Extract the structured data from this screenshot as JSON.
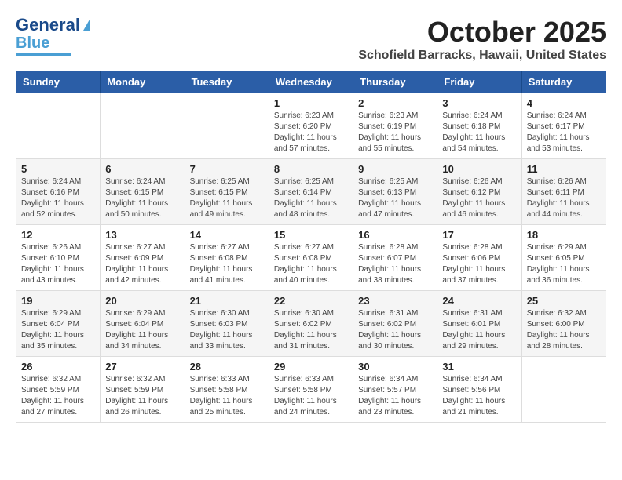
{
  "logo": {
    "line1": "General",
    "line2": "Blue"
  },
  "header": {
    "month": "October 2025",
    "location": "Schofield Barracks, Hawaii, United States"
  },
  "weekdays": [
    "Sunday",
    "Monday",
    "Tuesday",
    "Wednesday",
    "Thursday",
    "Friday",
    "Saturday"
  ],
  "weeks": [
    [
      {
        "day": "",
        "sunrise": "",
        "sunset": "",
        "daylight": ""
      },
      {
        "day": "",
        "sunrise": "",
        "sunset": "",
        "daylight": ""
      },
      {
        "day": "",
        "sunrise": "",
        "sunset": "",
        "daylight": ""
      },
      {
        "day": "1",
        "sunrise": "Sunrise: 6:23 AM",
        "sunset": "Sunset: 6:20 PM",
        "daylight": "Daylight: 11 hours and 57 minutes."
      },
      {
        "day": "2",
        "sunrise": "Sunrise: 6:23 AM",
        "sunset": "Sunset: 6:19 PM",
        "daylight": "Daylight: 11 hours and 55 minutes."
      },
      {
        "day": "3",
        "sunrise": "Sunrise: 6:24 AM",
        "sunset": "Sunset: 6:18 PM",
        "daylight": "Daylight: 11 hours and 54 minutes."
      },
      {
        "day": "4",
        "sunrise": "Sunrise: 6:24 AM",
        "sunset": "Sunset: 6:17 PM",
        "daylight": "Daylight: 11 hours and 53 minutes."
      }
    ],
    [
      {
        "day": "5",
        "sunrise": "Sunrise: 6:24 AM",
        "sunset": "Sunset: 6:16 PM",
        "daylight": "Daylight: 11 hours and 52 minutes."
      },
      {
        "day": "6",
        "sunrise": "Sunrise: 6:24 AM",
        "sunset": "Sunset: 6:15 PM",
        "daylight": "Daylight: 11 hours and 50 minutes."
      },
      {
        "day": "7",
        "sunrise": "Sunrise: 6:25 AM",
        "sunset": "Sunset: 6:15 PM",
        "daylight": "Daylight: 11 hours and 49 minutes."
      },
      {
        "day": "8",
        "sunrise": "Sunrise: 6:25 AM",
        "sunset": "Sunset: 6:14 PM",
        "daylight": "Daylight: 11 hours and 48 minutes."
      },
      {
        "day": "9",
        "sunrise": "Sunrise: 6:25 AM",
        "sunset": "Sunset: 6:13 PM",
        "daylight": "Daylight: 11 hours and 47 minutes."
      },
      {
        "day": "10",
        "sunrise": "Sunrise: 6:26 AM",
        "sunset": "Sunset: 6:12 PM",
        "daylight": "Daylight: 11 hours and 46 minutes."
      },
      {
        "day": "11",
        "sunrise": "Sunrise: 6:26 AM",
        "sunset": "Sunset: 6:11 PM",
        "daylight": "Daylight: 11 hours and 44 minutes."
      }
    ],
    [
      {
        "day": "12",
        "sunrise": "Sunrise: 6:26 AM",
        "sunset": "Sunset: 6:10 PM",
        "daylight": "Daylight: 11 hours and 43 minutes."
      },
      {
        "day": "13",
        "sunrise": "Sunrise: 6:27 AM",
        "sunset": "Sunset: 6:09 PM",
        "daylight": "Daylight: 11 hours and 42 minutes."
      },
      {
        "day": "14",
        "sunrise": "Sunrise: 6:27 AM",
        "sunset": "Sunset: 6:08 PM",
        "daylight": "Daylight: 11 hours and 41 minutes."
      },
      {
        "day": "15",
        "sunrise": "Sunrise: 6:27 AM",
        "sunset": "Sunset: 6:08 PM",
        "daylight": "Daylight: 11 hours and 40 minutes."
      },
      {
        "day": "16",
        "sunrise": "Sunrise: 6:28 AM",
        "sunset": "Sunset: 6:07 PM",
        "daylight": "Daylight: 11 hours and 38 minutes."
      },
      {
        "day": "17",
        "sunrise": "Sunrise: 6:28 AM",
        "sunset": "Sunset: 6:06 PM",
        "daylight": "Daylight: 11 hours and 37 minutes."
      },
      {
        "day": "18",
        "sunrise": "Sunrise: 6:29 AM",
        "sunset": "Sunset: 6:05 PM",
        "daylight": "Daylight: 11 hours and 36 minutes."
      }
    ],
    [
      {
        "day": "19",
        "sunrise": "Sunrise: 6:29 AM",
        "sunset": "Sunset: 6:04 PM",
        "daylight": "Daylight: 11 hours and 35 minutes."
      },
      {
        "day": "20",
        "sunrise": "Sunrise: 6:29 AM",
        "sunset": "Sunset: 6:04 PM",
        "daylight": "Daylight: 11 hours and 34 minutes."
      },
      {
        "day": "21",
        "sunrise": "Sunrise: 6:30 AM",
        "sunset": "Sunset: 6:03 PM",
        "daylight": "Daylight: 11 hours and 33 minutes."
      },
      {
        "day": "22",
        "sunrise": "Sunrise: 6:30 AM",
        "sunset": "Sunset: 6:02 PM",
        "daylight": "Daylight: 11 hours and 31 minutes."
      },
      {
        "day": "23",
        "sunrise": "Sunrise: 6:31 AM",
        "sunset": "Sunset: 6:02 PM",
        "daylight": "Daylight: 11 hours and 30 minutes."
      },
      {
        "day": "24",
        "sunrise": "Sunrise: 6:31 AM",
        "sunset": "Sunset: 6:01 PM",
        "daylight": "Daylight: 11 hours and 29 minutes."
      },
      {
        "day": "25",
        "sunrise": "Sunrise: 6:32 AM",
        "sunset": "Sunset: 6:00 PM",
        "daylight": "Daylight: 11 hours and 28 minutes."
      }
    ],
    [
      {
        "day": "26",
        "sunrise": "Sunrise: 6:32 AM",
        "sunset": "Sunset: 5:59 PM",
        "daylight": "Daylight: 11 hours and 27 minutes."
      },
      {
        "day": "27",
        "sunrise": "Sunrise: 6:32 AM",
        "sunset": "Sunset: 5:59 PM",
        "daylight": "Daylight: 11 hours and 26 minutes."
      },
      {
        "day": "28",
        "sunrise": "Sunrise: 6:33 AM",
        "sunset": "Sunset: 5:58 PM",
        "daylight": "Daylight: 11 hours and 25 minutes."
      },
      {
        "day": "29",
        "sunrise": "Sunrise: 6:33 AM",
        "sunset": "Sunset: 5:58 PM",
        "daylight": "Daylight: 11 hours and 24 minutes."
      },
      {
        "day": "30",
        "sunrise": "Sunrise: 6:34 AM",
        "sunset": "Sunset: 5:57 PM",
        "daylight": "Daylight: 11 hours and 23 minutes."
      },
      {
        "day": "31",
        "sunrise": "Sunrise: 6:34 AM",
        "sunset": "Sunset: 5:56 PM",
        "daylight": "Daylight: 11 hours and 21 minutes."
      },
      {
        "day": "",
        "sunrise": "",
        "sunset": "",
        "daylight": ""
      }
    ]
  ]
}
